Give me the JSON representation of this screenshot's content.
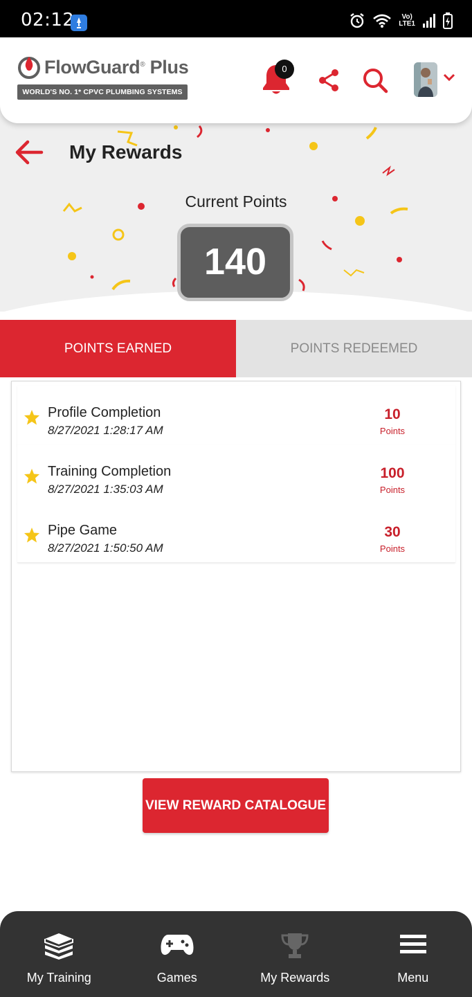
{
  "status_bar": {
    "time": "02:12",
    "lte_top": "Vo)",
    "lte_bottom": "LTE1"
  },
  "header": {
    "brand": "FlowGuard",
    "brand_reg": "®",
    "brand_suffix": " Plus",
    "tagline": "WORLD'S NO. 1* CPVC PLUMBING SYSTEMS",
    "notification_count": "0",
    "icons": [
      "bell-icon",
      "share-icon",
      "search-icon",
      "avatar",
      "chevron-down-icon"
    ]
  },
  "page": {
    "title": "My Rewards",
    "points_label": "Current Points",
    "points_value": "140"
  },
  "tabs": [
    {
      "label": "POINTS EARNED",
      "active": true
    },
    {
      "label": "POINTS REDEEMED",
      "active": false
    }
  ],
  "rewards": [
    {
      "title": "Profile Completion",
      "date": "8/27/2021 1:28:17 AM",
      "points": "10",
      "unit": "Points"
    },
    {
      "title": "Training Completion",
      "date": "8/27/2021 1:35:03 AM",
      "points": "100",
      "unit": "Points"
    },
    {
      "title": "Pipe Game",
      "date": "8/27/2021 1:50:50 AM",
      "points": "30",
      "unit": "Points"
    }
  ],
  "cta_label": "VIEW REWARD CATALOGUE",
  "bottom_nav": [
    {
      "label": "My Training",
      "icon": "books-icon"
    },
    {
      "label": "Games",
      "icon": "gamepad-icon"
    },
    {
      "label": "My Rewards",
      "icon": "trophy-icon"
    },
    {
      "label": "Menu",
      "icon": "menu-icon"
    }
  ],
  "colors": {
    "brand_red": "#dc2630",
    "points_box": "#5d5d5d",
    "nav_bg": "#333333",
    "star": "#f5c518"
  }
}
